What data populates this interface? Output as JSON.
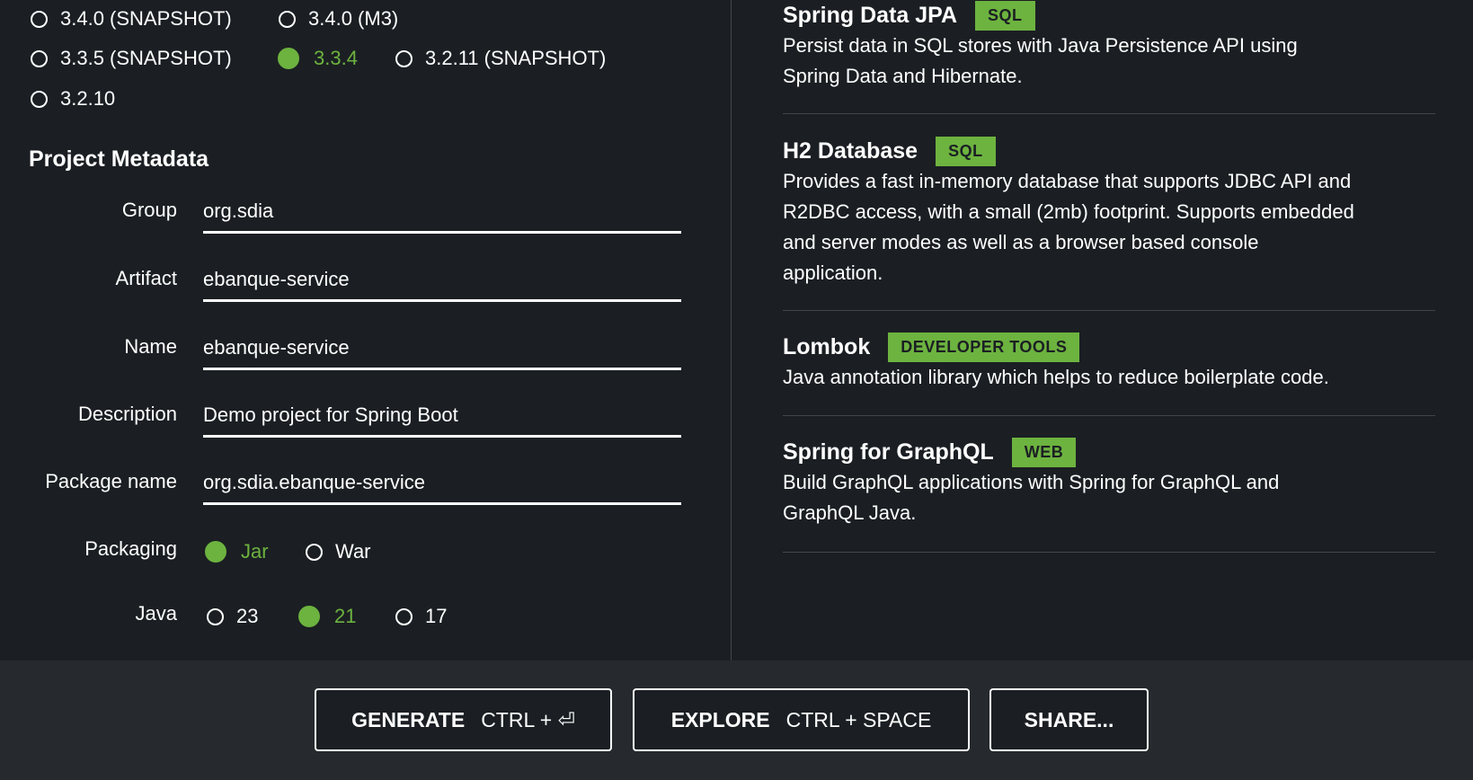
{
  "boot_versions": [
    {
      "label": "3.4.0 (SNAPSHOT)",
      "selected": false
    },
    {
      "label": "3.4.0 (M3)",
      "selected": false
    },
    {
      "label": "3.3.5 (SNAPSHOT)",
      "selected": false
    },
    {
      "label": "3.3.4",
      "selected": true
    },
    {
      "label": "3.2.11 (SNAPSHOT)",
      "selected": false
    },
    {
      "label": "3.2.10",
      "selected": false
    }
  ],
  "metadata": {
    "title": "Project Metadata",
    "fields": [
      {
        "label": "Group",
        "value": "org.sdia"
      },
      {
        "label": "Artifact",
        "value": "ebanque-service"
      },
      {
        "label": "Name",
        "value": "ebanque-service"
      },
      {
        "label": "Description",
        "value": "Demo project for Spring Boot"
      },
      {
        "label": "Package name",
        "value": "org.sdia.ebanque-service"
      }
    ],
    "packaging": {
      "label": "Packaging",
      "options": [
        {
          "label": "Jar",
          "selected": true
        },
        {
          "label": "War",
          "selected": false
        }
      ]
    },
    "java": {
      "label": "Java",
      "options": [
        {
          "label": "23",
          "selected": false
        },
        {
          "label": "21",
          "selected": true
        },
        {
          "label": "17",
          "selected": false
        }
      ]
    }
  },
  "dependencies": [
    {
      "name": "Spring Data JPA",
      "tag": "SQL",
      "description_lines": [
        "Persist data in SQL stores with Java Persistence API using",
        "Spring Data and Hibernate."
      ]
    },
    {
      "name": "H2 Database",
      "tag": "SQL",
      "description_lines": [
        "Provides a fast in-memory database that supports JDBC API and",
        "R2DBC access, with a small (2mb) footprint. Supports embedded",
        "and server modes as well as a browser based console",
        "application."
      ]
    },
    {
      "name": "Lombok",
      "tag": "DEVELOPER TOOLS",
      "description_lines": [
        "Java annotation library which helps to reduce boilerplate code."
      ]
    },
    {
      "name": "Spring for GraphQL",
      "tag": "WEB",
      "description_lines": [
        "Build GraphQL applications with Spring for GraphQL and",
        "GraphQL Java."
      ]
    }
  ],
  "footer": {
    "generate_label": "GENERATE",
    "generate_shortcut": "CTRL + ⏎",
    "explore_label": "EXPLORE",
    "explore_shortcut": "CTRL + SPACE",
    "share_label": "SHARE..."
  },
  "colors": {
    "background": "#1b1f23",
    "footer_background": "#262a2e",
    "accent": "#6db33f",
    "text": "#ffffff",
    "divider": "#40464d"
  }
}
